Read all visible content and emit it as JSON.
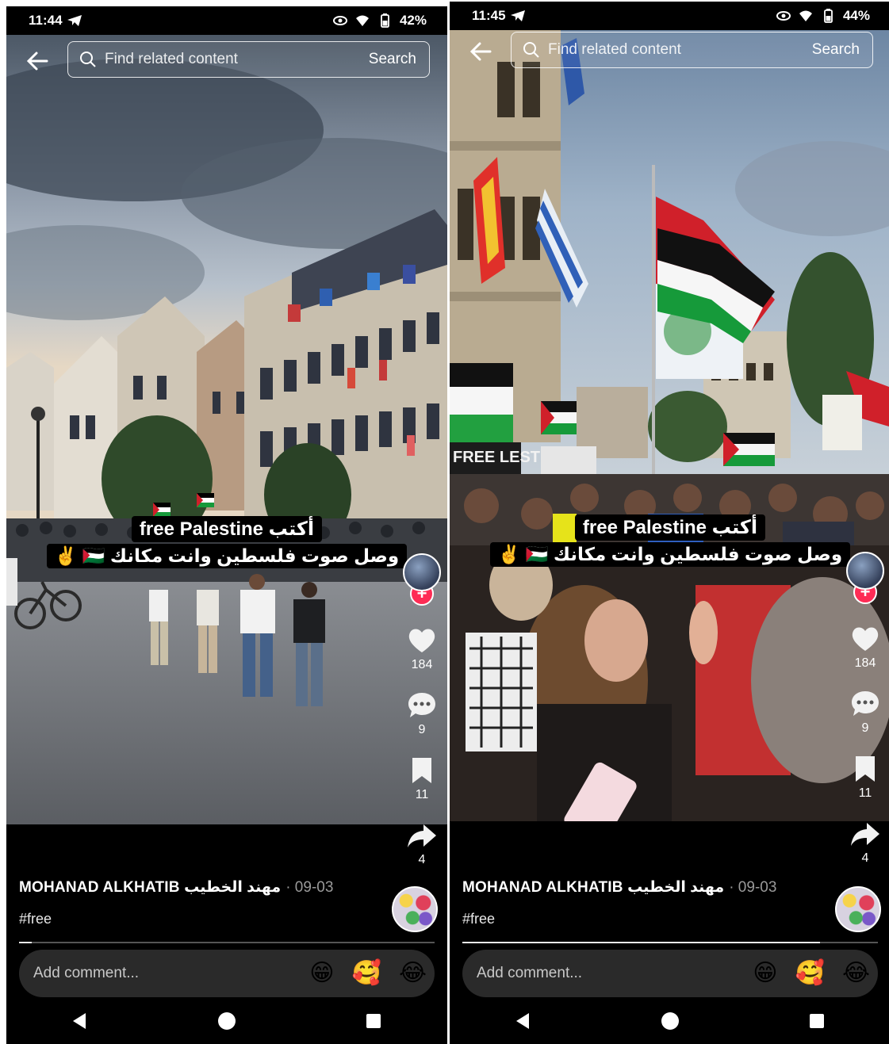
{
  "screens": [
    {
      "status": {
        "time": "11:44",
        "battery": "42%"
      },
      "search": {
        "placeholder": "Find related content",
        "button": "Search"
      },
      "caption": {
        "line1": "أكتب free Palestine",
        "line2": "وصل صوت فلسطين وانت مكانك 🇵🇸 ✌️"
      },
      "actions": {
        "likes": "184",
        "comments": "9",
        "saves": "11",
        "shares": "4"
      },
      "author": {
        "name": "MOHANAD ALKHATIB مهند الخطيب",
        "date": "· 09-03",
        "hashtag": "#free"
      },
      "progress": 0.03,
      "comment": {
        "placeholder": "Add comment...",
        "emojis": [
          "😁",
          "🥰",
          "😂"
        ]
      }
    },
    {
      "status": {
        "time": "11:45",
        "battery": "44%"
      },
      "search": {
        "placeholder": "Find related content",
        "button": "Search"
      },
      "caption": {
        "line1": "أكتب free Palestine",
        "line2": "وصل صوت فلسطين وانت مكانك 🇵🇸 ✌️"
      },
      "actions": {
        "likes": "184",
        "comments": "9",
        "saves": "11",
        "shares": "4"
      },
      "author": {
        "name": "MOHANAD ALKHATIB مهند الخطيب",
        "date": "· 09-03",
        "hashtag": "#free"
      },
      "progress": 0.86,
      "comment": {
        "placeholder": "Add comment...",
        "emojis": [
          "😁",
          "🥰",
          "😂"
        ]
      },
      "scene_text": "FREE LESTINA"
    }
  ],
  "colors": {
    "accent": "#fe2c55",
    "background": "#000000"
  },
  "icons": [
    "telegram-icon",
    "eye-icon",
    "wifi-icon",
    "battery-icon",
    "back-arrow-icon",
    "search-icon",
    "heart-icon",
    "comment-icon",
    "bookmark-icon",
    "share-icon",
    "nav-back-icon",
    "nav-home-icon",
    "nav-recents-icon"
  ]
}
